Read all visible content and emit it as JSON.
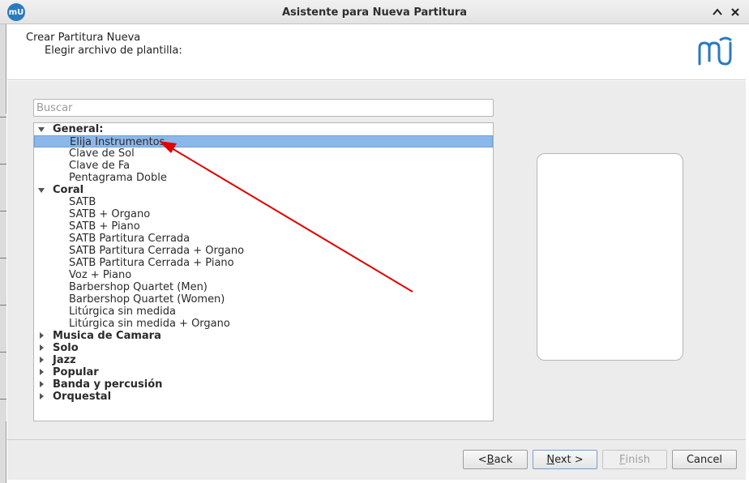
{
  "window": {
    "title": "Asistente para Nueva Partitura",
    "app_icon_text": "mU"
  },
  "header": {
    "title": "Crear Partitura Nueva",
    "subtitle": "Elegir archivo de plantilla:"
  },
  "search": {
    "placeholder": "Buscar",
    "value": ""
  },
  "tree": {
    "general": {
      "label": "General:",
      "items": [
        "Elija Instrumentos",
        "Clave de Sol",
        "Clave de Fa",
        "Pentagrama Doble"
      ]
    },
    "coral": {
      "label": "Coral",
      "items": [
        "SATB",
        "SATB + Organo",
        "SATB + Piano",
        "SATB Partitura Cerrada",
        "SATB Partitura Cerrada + Organo",
        "SATB Partitura Cerrada + Piano",
        "Voz + Piano",
        "Barbershop Quartet (Men)",
        "Barbershop Quartet (Women)",
        "Litúrgica sin medida",
        "Litúrgica sin medida + Organo"
      ]
    },
    "collapsed": [
      "Musica de Camara",
      "Solo",
      "Jazz",
      "Popular",
      "Banda y percusión",
      "Orquestal"
    ],
    "selected_item": "Elija Instrumentos"
  },
  "buttons": {
    "back": {
      "pre": "< ",
      "mnemonic": "B",
      "post": "ack"
    },
    "next": {
      "pre": "",
      "mnemonic": "N",
      "post": "ext >"
    },
    "finish": {
      "pre": "",
      "mnemonic": "F",
      "post": "inish"
    },
    "cancel": {
      "pre": "Cancel",
      "mnemonic": "",
      "post": ""
    }
  },
  "colors": {
    "selection": "#8bb8ea",
    "annotation_arrow": "#e00000",
    "logo": "#2a7ac0"
  }
}
